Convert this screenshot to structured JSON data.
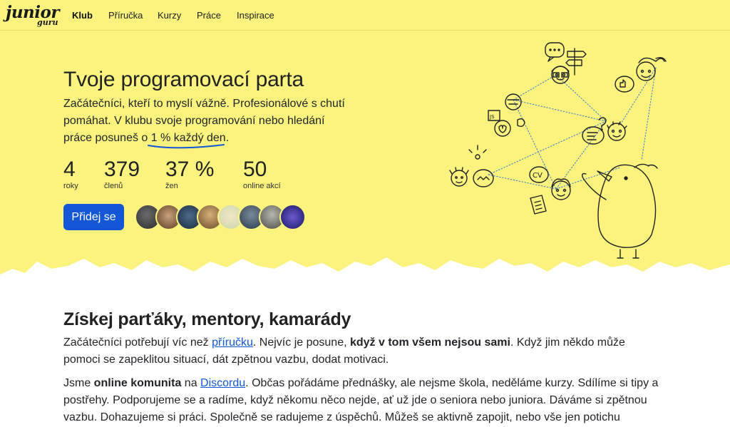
{
  "logo": {
    "word1": "junior",
    "word2": "guru"
  },
  "nav": {
    "items": [
      "Klub",
      "Příručka",
      "Kurzy",
      "Práce",
      "Inspirace"
    ],
    "active": "Klub"
  },
  "hero": {
    "title": "Tvoje programovací parta",
    "text_before": "Začátečníci, kteří to myslí vážně. Profesionálové s chutí pomáhat. V klubu svoje programování nebo hledání práce posuneš o ",
    "text_highlight": "1 % každý den",
    "text_after": ".",
    "stats": [
      {
        "value": "4",
        "label": "roky"
      },
      {
        "value": "379",
        "label": "členů"
      },
      {
        "value": "37 %",
        "label": "žen"
      },
      {
        "value": "50",
        "label": "online akcí"
      }
    ],
    "join_button": "Přidej se"
  },
  "colors": {
    "background": "#fbf37e",
    "accent": "#1357d6",
    "text": "#212529"
  },
  "section": {
    "title": "Získej parťáky, mentory, kamarády",
    "p1": {
      "a": "Začátečníci potřebují víc než ",
      "link": "příručku",
      "b": ". Nejvíc je posune, ",
      "bold": "když v tom všem nejsou sami",
      "c": ". Když jim někdo může pomoci se zapeklitou situací, dát zpětnou vazbu, dodat motivaci."
    },
    "p2": {
      "a": "Jsme ",
      "bold": "online komunita",
      "b": " na ",
      "link": "Discordu",
      "c": ". Občas pořádáme přednášky, ale nejsme škola, neděláme kurzy. Sdílíme si tipy a postřehy. Podporujeme se a radíme, když někomu něco nejde, ať už jde o seniora nebo juniora. Dáváme si zpětnou vazbu. Dohazujeme si práci. Společně se radujeme z úspěchů. Můžeš se aktivně zapojit, nebo vše jen potichu sledovat."
    }
  }
}
